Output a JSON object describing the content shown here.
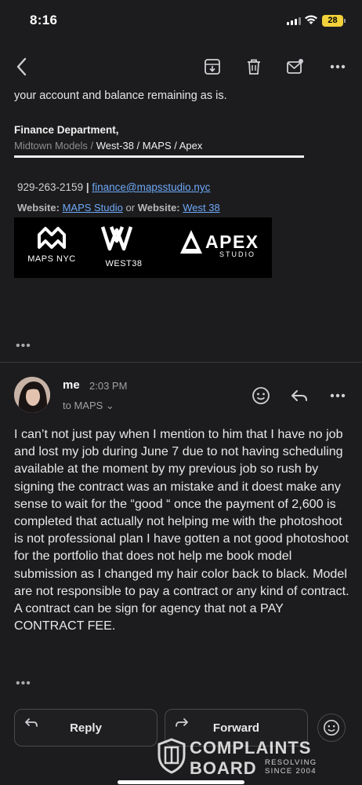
{
  "status_bar": {
    "time": "8:16",
    "battery": "28"
  },
  "toolbar": {
    "icons": [
      "back-icon",
      "archive-icon",
      "trash-icon",
      "mark-unread-icon",
      "more-icon"
    ]
  },
  "previous_message": {
    "intro_text": "your account and balance remaining as is.",
    "signature_title": "Finance Department,",
    "orgs_dim": "Midtown Models / ",
    "orgs_rest": "West-38 / MAPS / Apex",
    "phone": "929-263-2159",
    "separator": " | ",
    "email": "finance@mapsstudio.nyc",
    "website_label_1": "Website:",
    "website_link_1": "MAPS Studio",
    "website_or": " or ",
    "website_label_2": "Website:",
    "website_link_2": "West 38",
    "logos": {
      "maps": "MAPS NYC",
      "west": "WEST38",
      "apex_title": "APEX",
      "apex_sub": "STUDIO"
    },
    "more": "•••"
  },
  "message": {
    "sender": "me",
    "time": "2:03 PM",
    "recipient": "to MAPS",
    "body": "I can’t not just pay when I mention to him that I have no job and lost my job during June 7 due to not having scheduling available at the moment by my previous job so rush by signing the contract was an mistake and it doest make any sense to wait for the “good “ once the payment of 2,600 is completed that actually not helping me with the photoshoot is not professional plan I have gotten a not good photoshoot for the portfolio that does not help me book model submission as I changed my hair color back to black. Model are not responsible to pay a contract or any kind of contract. A contract can be sign for agency that not a PAY CONTRACT FEE.",
    "more": "•••"
  },
  "actions": {
    "reply": "Reply",
    "forward": "Forward"
  },
  "watermark": {
    "line1": "COMPLAINTS",
    "line2": "BOARD",
    "tag1": "RESOLVING",
    "tag2": "SINCE 2004"
  },
  "colors": {
    "background": "#1c1c1e",
    "link": "#6ea8f7",
    "battery": "#f2d13a"
  }
}
